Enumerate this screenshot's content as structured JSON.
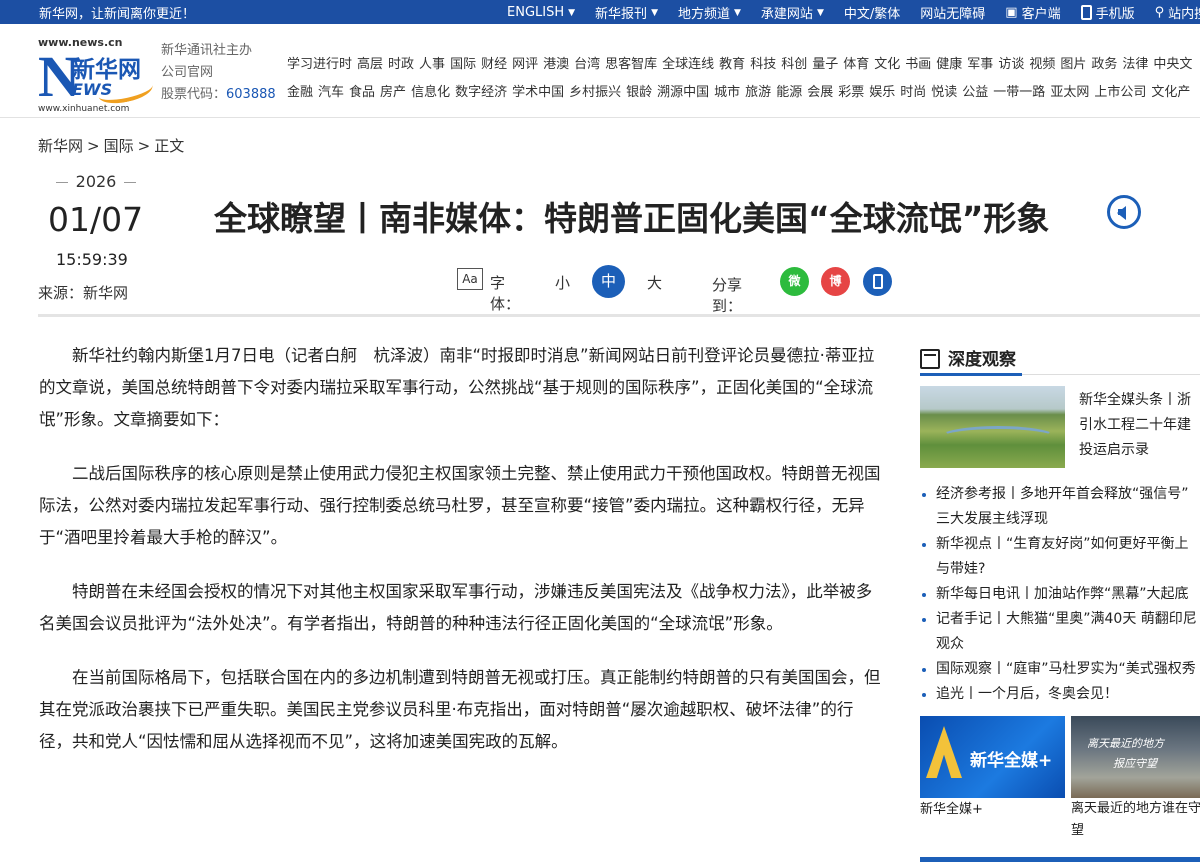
{
  "topbar": {
    "slogan": "新华网，让新闻离你更近！",
    "items": [
      {
        "label": "ENGLISH",
        "caret": true
      },
      {
        "label": "新华报刊",
        "caret": true
      },
      {
        "label": "地方频道",
        "caret": true
      },
      {
        "label": "承建网站",
        "caret": true
      },
      {
        "label": "中文/繁体",
        "caret": false
      },
      {
        "label": "网站无障碍",
        "caret": false
      },
      {
        "label": "客户端",
        "icon": "phone-icon"
      },
      {
        "label": "手机版",
        "icon": "mobile-icon"
      },
      {
        "label": "站内搜",
        "icon": "search-icon"
      }
    ]
  },
  "logo": {
    "url_top": "www.news.cn",
    "letter": "N",
    "name": "新华网",
    "ews": "EWS",
    "url_bottom": "www.xinhuanet.com"
  },
  "official": {
    "line1": "新华通讯社主办",
    "line2": "公司官网",
    "stock_label": "股票代码：",
    "stock_code": "603888"
  },
  "nav": {
    "row1": [
      "学习进行时",
      "高层",
      "时政",
      "人事",
      "国际",
      "财经",
      "网评",
      "港澳",
      "台湾",
      "思客智库",
      "全球连线",
      "教育",
      "科技",
      "科创",
      "量子",
      "体育",
      "文化",
      "书画",
      "健康",
      "军事",
      "访谈",
      "视频",
      "图片",
      "政务",
      "法律",
      "中央文"
    ],
    "row2": [
      "金融",
      "汽车",
      "食品",
      "房产",
      "信息化",
      "数字经济",
      "学术中国",
      "乡村振兴",
      "银龄",
      "溯源中国",
      "城市",
      "旅游",
      "能源",
      "会展",
      "彩票",
      "娱乐",
      "时尚",
      "悦读",
      "公益",
      "一带一路",
      "亚太网",
      "上市公司",
      "文化产"
    ]
  },
  "breadcrumb": {
    "home": "新华网",
    "sep1": ">",
    "section": "国际",
    "sep2": ">",
    "current": "正文"
  },
  "meta": {
    "year": "2026",
    "month_day": "01/07",
    "time": "15:59:39",
    "source": "来源：新华网"
  },
  "title": "全球瞭望丨南非媒体：特朗普正固化美国“全球流氓”形象",
  "tools": {
    "font_icon": "Aa",
    "font_label": "字体：",
    "small": "小",
    "medium": "中",
    "large": "大",
    "share_label": "分享到：",
    "share": [
      {
        "name": "wechat",
        "glyph": "微"
      },
      {
        "name": "weibo",
        "glyph": "博"
      },
      {
        "name": "mobile",
        "glyph": ""
      }
    ]
  },
  "article": {
    "paragraphs": [
      "新华社约翰内斯堡1月7日电（记者白舸　杭泽波）南非“时报即时消息”新闻网站日前刊登评论员曼德拉·蒂亚拉的文章说，美国总统特朗普下令对委内瑞拉采取军事行动，公然挑战“基于规则的国际秩序”，正固化美国的“全球流氓”形象。文章摘要如下：",
      "二战后国际秩序的核心原则是禁止使用武力侵犯主权国家领土完整、禁止使用武力干预他国政权。特朗普无视国际法，公然对委内瑞拉发起军事行动、强行控制委总统马杜罗，甚至宣称要“接管”委内瑞拉。这种霸权行径，无异于“酒吧里拎着最大手枪的醉汉”。",
      "特朗普在未经国会授权的情况下对其他主权国家采取军事行动，涉嫌违反美国宪法及《战争权力法》，此举被多名美国会议员批评为“法外处决”。有学者指出，特朗普的种种违法行径正固化美国的“全球流氓”形象。",
      "在当前国际格局下，包括联合国在内的多边机制遭到特朗普无视或打压。真正能制约特朗普的只有美国国会，但其在党派政治裹挟下已严重失职。美国民主党参议员科里·布克指出，面对特朗普“屡次逾越职权、破坏法律”的行径，共和党人“因怯懦和屈从选择视而不见”，这将加速美国宪政的瓦解。"
    ]
  },
  "sidebar": {
    "heading": "深度观察",
    "featured": {
      "lines": [
        "新华全媒头条丨浙",
        "引水工程二十年建",
        "投运启示录"
      ]
    },
    "items": [
      {
        "lines": [
          "经济参考报丨多地开年首会释放“强信号”",
          "三大发展主线浮现"
        ]
      },
      {
        "lines": [
          "新华视点丨“生育友好岗”如何更好平衡上",
          "与带娃?"
        ]
      },
      {
        "lines": [
          "新华每日电讯丨加油站作弊“黑幕”大起底"
        ]
      },
      {
        "lines": [
          "记者手记丨大熊猫“里奥”满40天 萌翻印尼",
          "观众"
        ]
      },
      {
        "lines": [
          "国际观察丨“庭审”马杜罗实为“美式强权秀"
        ]
      },
      {
        "lines": [
          "追光丨一个月后，冬奥会见！"
        ]
      }
    ],
    "promo1": {
      "image_text": "新华全媒+",
      "caption": "新华全媒+"
    },
    "promo2": {
      "image_line1": "离天最近的地方",
      "image_line2": "报应守望",
      "caption_line1": "离天最近的地方谁在守",
      "caption_line2": "望"
    }
  },
  "colors": {
    "brand_blue": "#1c4fa3",
    "accent_blue": "#1c5fb8",
    "wechat_green": "#2dbb3d",
    "weibo_red": "#e64545"
  }
}
